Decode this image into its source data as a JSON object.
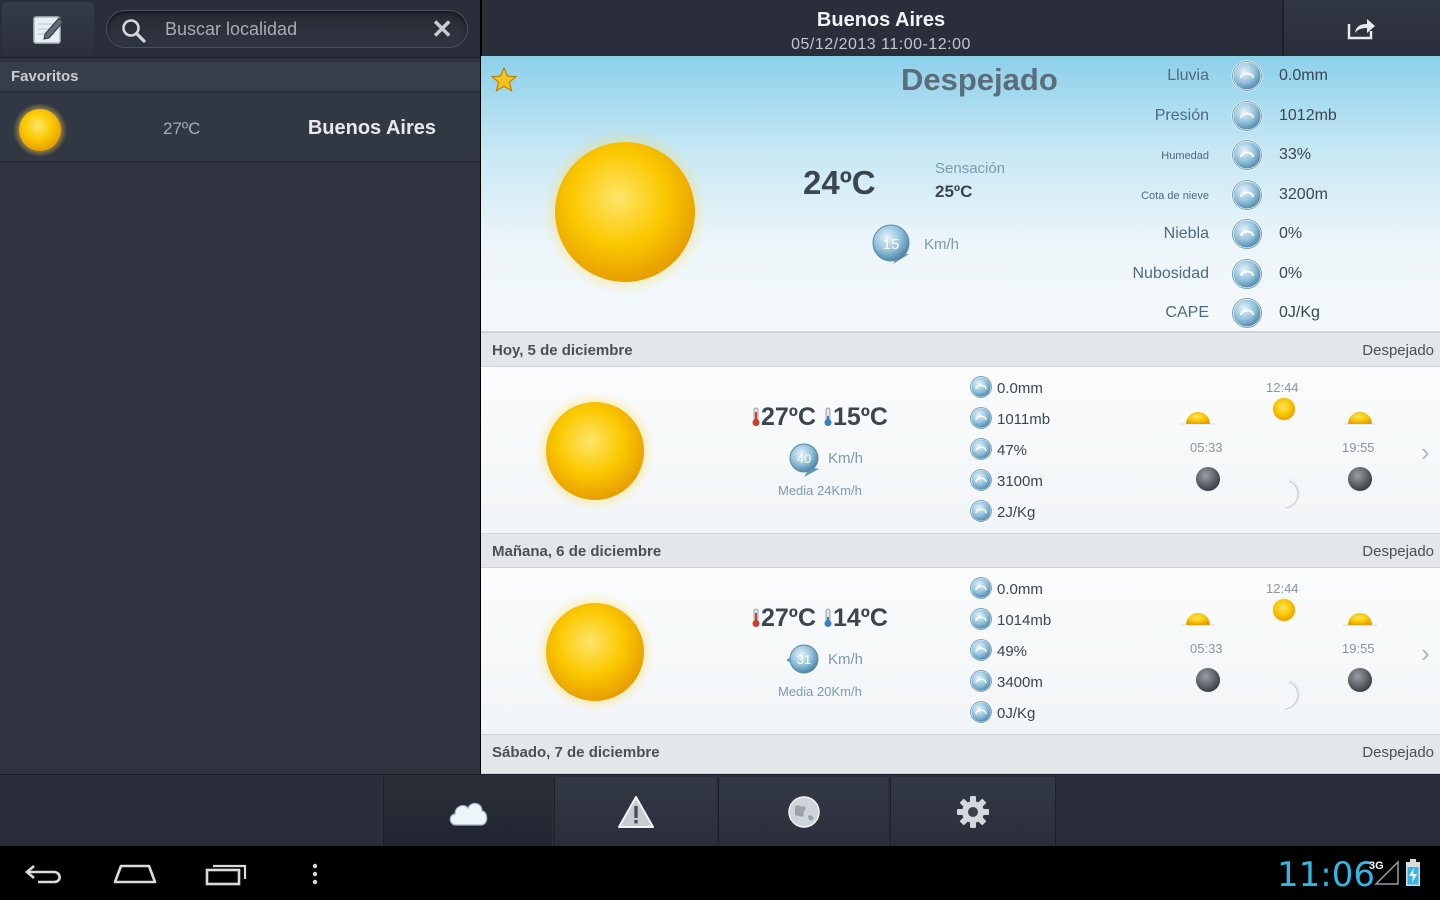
{
  "sidebar": {
    "search_placeholder": "Buscar localidad",
    "favorites_label": "Favoritos",
    "favorites": [
      {
        "temp": "27ºC",
        "city": "Buenos Aires",
        "icon": "sun-icon"
      }
    ]
  },
  "header": {
    "city": "Buenos Aires",
    "period": "05/12/2013 11:00-12:00"
  },
  "current": {
    "condition": "Despejado",
    "temperature": "24ºC",
    "feels_like_label": "Sensación",
    "feels_like_value": "25ºC",
    "wind_speed": "15",
    "wind_unit": "Km/h",
    "params": [
      {
        "label": "Lluvia",
        "value": "0.0mm",
        "icon": "rain-gauge-icon"
      },
      {
        "label": "Presión",
        "value": "1012mb",
        "icon": "pressure-icon"
      },
      {
        "label": "Humedad",
        "value": "33%",
        "icon": "humidity-icon"
      },
      {
        "label": "Cota de nieve",
        "value": "3200m",
        "icon": "snowflake-icon"
      },
      {
        "label": "Niebla",
        "value": "0%",
        "icon": "fog-icon"
      },
      {
        "label": "Nubosidad",
        "value": "0%",
        "icon": "cloud-cover-icon"
      },
      {
        "label": "CAPE",
        "value": "0J/Kg",
        "icon": "cape-icon"
      }
    ]
  },
  "days": [
    {
      "name": "Hoy, 5 de diciembre",
      "condition": "Despejado",
      "max": "27ºC",
      "min": "15ºC",
      "wind": "40",
      "wind_unit": "Km/h",
      "wind_avg": "Media 24Km/h",
      "rain": "0.0mm",
      "pressure": "1011mb",
      "humidity": "47%",
      "snow": "3100m",
      "cape": "2J/Kg",
      "noon": "12:44",
      "sunrise": "05:33",
      "sunset": "19:55"
    },
    {
      "name": "Mañana, 6 de diciembre",
      "condition": "Despejado",
      "max": "27ºC",
      "min": "14ºC",
      "wind": "31",
      "wind_unit": "Km/h",
      "wind_avg": "Media 20Km/h",
      "rain": "0.0mm",
      "pressure": "1014mb",
      "humidity": "49%",
      "snow": "3400m",
      "cape": "0J/Kg",
      "noon": "12:44",
      "sunrise": "05:33",
      "sunset": "19:55"
    },
    {
      "name": "Sábado, 7 de diciembre",
      "condition": "Despejado"
    }
  ],
  "tabs": [
    {
      "name": "tab-forecast",
      "icon": "cloud-icon",
      "active": true
    },
    {
      "name": "tab-alerts",
      "icon": "warning-icon",
      "active": false
    },
    {
      "name": "tab-map",
      "icon": "globe-icon",
      "active": false
    },
    {
      "name": "tab-settings",
      "icon": "gear-icon",
      "active": false
    }
  ],
  "system": {
    "clock": "11:06",
    "network": "3G"
  },
  "colors": {
    "accent_clock": "#33b5e5",
    "panel_dark": "#2f3340",
    "sky_top": "#8cd0ea",
    "sun": "#f5c200"
  }
}
